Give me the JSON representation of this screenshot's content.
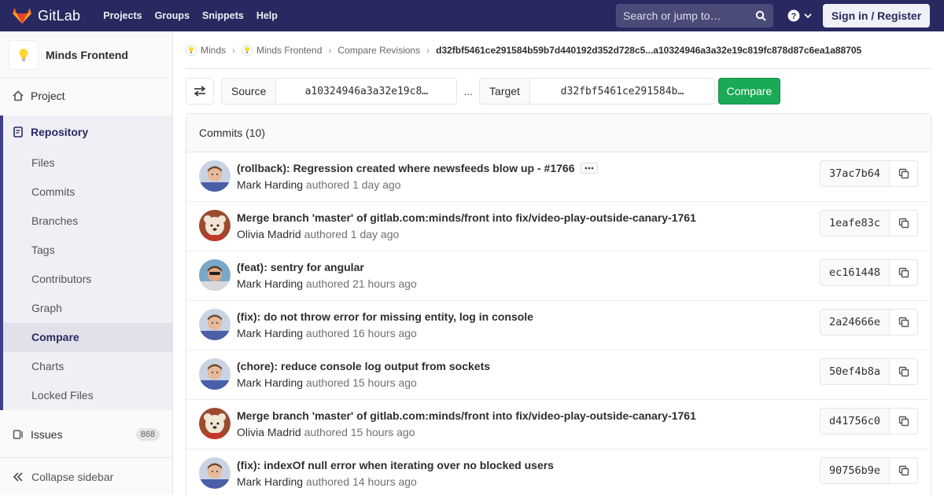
{
  "navbar": {
    "brand": "GitLab",
    "links": [
      "Projects",
      "Groups",
      "Snippets",
      "Help"
    ],
    "search_placeholder": "Search or jump to…",
    "signin": "Sign in / Register"
  },
  "sidebar": {
    "project_name": "Minds Frontend",
    "project_label": "Project",
    "repository_label": "Repository",
    "repo_items": [
      "Files",
      "Commits",
      "Branches",
      "Tags",
      "Contributors",
      "Graph",
      "Compare",
      "Charts",
      "Locked Files"
    ],
    "active_item": "Compare",
    "issues_label": "Issues",
    "issues_count": "868",
    "collapse_label": "Collapse sidebar"
  },
  "breadcrumbs": {
    "items": [
      "Minds",
      "Minds Frontend",
      "Compare Revisions"
    ],
    "current": "d32fbf5461ce291584b59b7d440192d352d728c5...a10324946a3a32e19c819fc878d87c6ea1a88705"
  },
  "compare": {
    "source_label": "Source",
    "source_value": "a10324946a3a32e19c8…",
    "separator": "...",
    "target_label": "Target",
    "target_value": "d32fbf5461ce291584b…",
    "button": "Compare"
  },
  "commits": {
    "header": "Commits (10)",
    "authored_word": "authored",
    "rows": [
      {
        "title": "(rollback): Regression created where newsfeeds blow up - #1766",
        "author": "Mark Harding",
        "time": "1 day ago",
        "sha": "37ac7b64",
        "avatar": "mark-a"
      },
      {
        "title": "Merge branch 'master' of gitlab.com:minds/front into fix/video-play-outside-canary-1761",
        "author": "Olivia Madrid",
        "time": "1 day ago",
        "sha": "1eafe83c",
        "avatar": "olivia"
      },
      {
        "title": "(feat): sentry for angular",
        "author": "Mark Harding",
        "time": "21 hours ago",
        "sha": "ec161448",
        "avatar": "mark-b"
      },
      {
        "title": "(fix): do not throw error for missing entity, log in console",
        "author": "Mark Harding",
        "time": "16 hours ago",
        "sha": "2a24666e",
        "avatar": "mark-a"
      },
      {
        "title": "(chore): reduce console log output from sockets",
        "author": "Mark Harding",
        "time": "15 hours ago",
        "sha": "50ef4b8a",
        "avatar": "mark-a"
      },
      {
        "title": "Merge branch 'master' of gitlab.com:minds/front into fix/video-play-outside-canary-1761",
        "author": "Olivia Madrid",
        "time": "15 hours ago",
        "sha": "d41756c0",
        "avatar": "olivia"
      },
      {
        "title": "(fix): indexOf null error when iterating over no blocked users",
        "author": "Mark Harding",
        "time": "14 hours ago",
        "sha": "90756b9e",
        "avatar": "mark-a"
      }
    ]
  },
  "colors": {
    "navbar": "#292961",
    "compare_button": "#1aaa55",
    "sidebar_accent": "#3f3f8a"
  }
}
